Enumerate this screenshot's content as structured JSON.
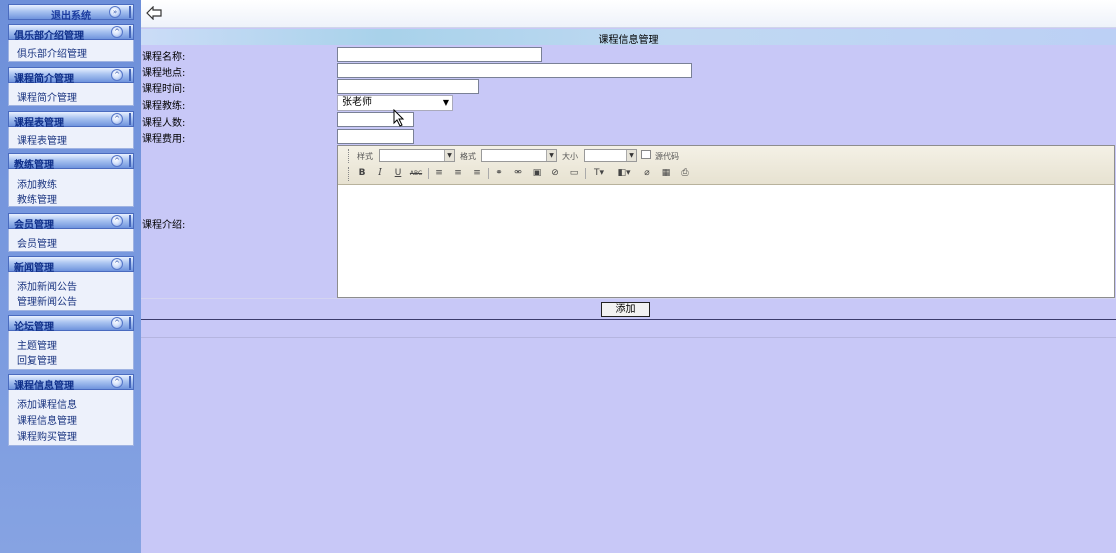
{
  "sidebar": {
    "logout": "退出系统",
    "sections": [
      {
        "title": "俱乐部介绍管理",
        "items": [
          "俱乐部介绍管理"
        ]
      },
      {
        "title": "课程简介管理",
        "items": [
          "课程简介管理"
        ]
      },
      {
        "title": "课程表管理",
        "items": [
          "课程表管理"
        ]
      },
      {
        "title": "教练管理",
        "items": [
          "添加教练",
          "教练管理"
        ]
      },
      {
        "title": "会员管理",
        "items": [
          "会员管理"
        ]
      },
      {
        "title": "新闻管理",
        "items": [
          "添加新闻公告",
          "管理新闻公告"
        ]
      },
      {
        "title": "论坛管理",
        "items": [
          "主题管理",
          "回复管理"
        ]
      },
      {
        "title": "课程信息管理",
        "items": [
          "添加课程信息",
          "课程信息管理",
          "课程购买管理"
        ]
      }
    ]
  },
  "page": {
    "title": "课程信息管理"
  },
  "form": {
    "name_label": "课程名称:",
    "location_label": "课程地点:",
    "time_label": "课程时间:",
    "coach_label": "课程教练:",
    "coach_value": "张老师",
    "count_label": "课程人数:",
    "fee_label": "课程费用:",
    "intro_label": "课程介绍:",
    "submit_label": "添加"
  },
  "editor": {
    "style_label": "样式",
    "format_label": "格式",
    "size_label": "大小",
    "source_label": "源代码"
  },
  "colors": {
    "background": "#c8c8f7",
    "sidebar": "#7b9be0",
    "toolbar": "#ece8d8"
  }
}
